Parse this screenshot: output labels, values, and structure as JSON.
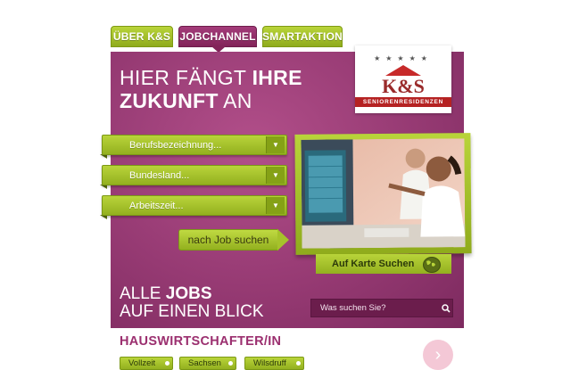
{
  "tabs": [
    {
      "label": "ÜBER K&S",
      "active": false
    },
    {
      "label": "JOBCHANNEL",
      "active": true
    },
    {
      "label": "SMARTAKTION",
      "active": false
    }
  ],
  "headline": {
    "line1_regular": "HIER FÄNGT ",
    "line1_bold": "IHRE",
    "line2_bold": "ZUKUNFT",
    "line2_regular": " AN"
  },
  "logo": {
    "brand": "K&S",
    "subtitle": "SENIORENRESIDENZEN"
  },
  "filters": [
    {
      "label": "Berufsbezeichnung..."
    },
    {
      "label": "Bundesland..."
    },
    {
      "label": "Arbeitszeit..."
    }
  ],
  "search_button": {
    "label": "nach Job suchen"
  },
  "map_search": {
    "label": "Auf Karte Suchen"
  },
  "promo": {
    "line1_regular": "ALLE ",
    "line1_bold": "JOBS",
    "line2": "AUF EINEN BLICK"
  },
  "search": {
    "placeholder": "Was suchen Sie?"
  },
  "job": {
    "title": "HAUSWIRTSCHAFTER/IN",
    "tags": [
      "Vollzeit",
      "Sachsen",
      "Wilsdruff"
    ]
  },
  "colors": {
    "brand_purple": "#963a73",
    "brand_green": "#a6c22b",
    "logo_red": "#b52222"
  },
  "icons": {
    "globe": "globe-icon",
    "search": "search-icon",
    "next": "chevron-right-icon",
    "dropdown": "chevron-down-icon"
  }
}
